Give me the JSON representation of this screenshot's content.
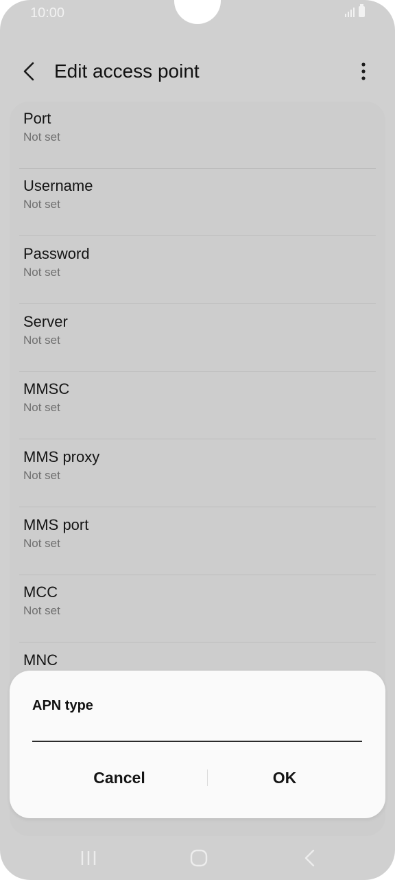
{
  "status_bar": {
    "time": "10:00"
  },
  "app_bar": {
    "title": "Edit access point"
  },
  "list": {
    "items": [
      {
        "title": "Port",
        "value": "Not set"
      },
      {
        "title": "Username",
        "value": "Not set"
      },
      {
        "title": "Password",
        "value": "Not set"
      },
      {
        "title": "Server",
        "value": "Not set"
      },
      {
        "title": "MMSC",
        "value": "Not set"
      },
      {
        "title": "MMS proxy",
        "value": "Not set"
      },
      {
        "title": "MMS port",
        "value": "Not set"
      },
      {
        "title": "MCC",
        "value": "Not set"
      },
      {
        "title": "MNC",
        "value": ""
      }
    ]
  },
  "dialog": {
    "title": "APN type",
    "input_value": "",
    "cancel_label": "Cancel",
    "ok_label": "OK"
  },
  "colors": {
    "dim_background": "#d0d0d0",
    "dialog_background": "#fafafa",
    "text_primary": "#141414",
    "text_secondary": "#6f6f6f"
  },
  "icons": {
    "back": "chevron-left-icon",
    "more": "more-vertical-icon",
    "nav_recents": "recents-icon",
    "nav_home": "home-icon",
    "nav_back": "back-icon",
    "signal": "signal-icon",
    "battery": "battery-icon"
  }
}
